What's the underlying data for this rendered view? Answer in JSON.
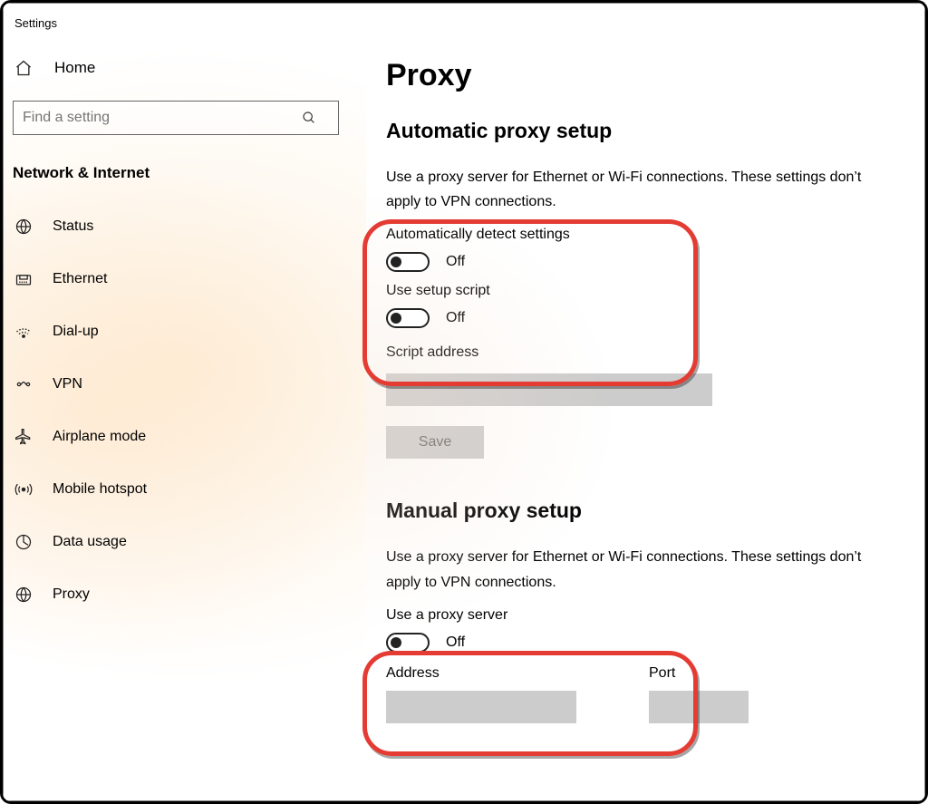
{
  "window_title": "Settings",
  "home_label": "Home",
  "search_placeholder": "Find a setting",
  "section_title": "Network & Internet",
  "nav": [
    {
      "icon": "status",
      "label": "Status"
    },
    {
      "icon": "ethernet",
      "label": "Ethernet"
    },
    {
      "icon": "dialup",
      "label": "Dial-up"
    },
    {
      "icon": "vpn",
      "label": "VPN"
    },
    {
      "icon": "airplane",
      "label": "Airplane mode"
    },
    {
      "icon": "hotspot",
      "label": "Mobile hotspot"
    },
    {
      "icon": "data",
      "label": "Data usage"
    },
    {
      "icon": "proxy",
      "label": "Proxy"
    }
  ],
  "page": {
    "title": "Proxy",
    "auto": {
      "heading": "Automatic proxy setup",
      "description": "Use a proxy server for Ethernet or Wi-Fi connections. These settings don’t apply to VPN connections.",
      "detect_label": "Automatically detect settings",
      "detect_state": "Off",
      "script_label": "Use setup script",
      "script_state": "Off",
      "script_addr_label": "Script address",
      "script_addr_value": "",
      "save_btn": "Save"
    },
    "manual": {
      "heading": "Manual proxy setup",
      "description": "Use a proxy server for Ethernet or Wi-Fi connections. These settings don’t apply to VPN connections.",
      "use_label": "Use a proxy server",
      "use_state": "Off",
      "address_label": "Address",
      "address_value": "",
      "port_label": "Port",
      "port_value": ""
    }
  }
}
